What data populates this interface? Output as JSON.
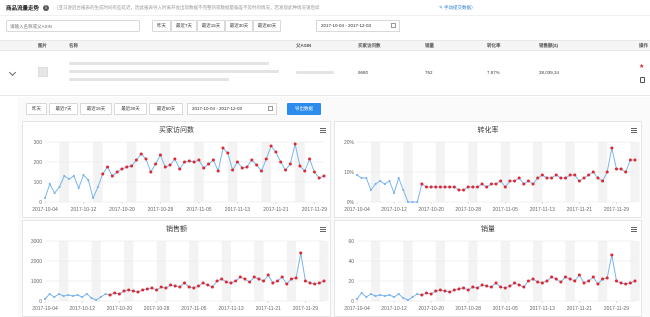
{
  "header": {
    "title": "商品流量走势",
    "info_icon": "info-circle-icon",
    "notice": "(亚马逊后台报表的生成时间有些延迟，因此报表导入时离开会出现数据不完整的或数据量偏差不及时的情况，若发现此种情况请后续",
    "link": "✎ 手动提交数据）"
  },
  "toolbar": {
    "search_placeholder": "请输入名称或父ASIN",
    "ranges": [
      "昨天",
      "最近7天",
      "最近15天",
      "最近30天",
      "最近60天"
    ],
    "date_range": "2017-10-04 - 2017-12-03"
  },
  "table": {
    "columns": [
      "图片",
      "名称",
      "父ASIN",
      "买家访问数",
      "销量",
      "转化率",
      "销售额($)",
      "操作"
    ],
    "row": {
      "visits": "9680",
      "units": "762",
      "conversion": "7.87%",
      "sales": "38,039.34"
    }
  },
  "panel": {
    "ranges": [
      "昨天",
      "最近7天",
      "最近15天",
      "最近30天",
      "最近60天"
    ],
    "date_range": "2017-10-04 - 2017-12-03",
    "export_label": "导出数据"
  },
  "colors": {
    "blue": "#7cb5ec",
    "red": "#e0262f",
    "accent": "#2b8ceb"
  },
  "chart_data": [
    {
      "type": "line",
      "title": "买家访问数",
      "x_ticks": [
        "2017-10-04",
        "2017-10-12",
        "2017-10-20",
        "2017-10-28",
        "2017-11-05",
        "2017-11-13",
        "2017-11-21",
        "2017-11-29"
      ],
      "y_ticks": [
        "300",
        "200",
        "100",
        "0"
      ],
      "ylim": [
        0,
        300
      ],
      "values": [
        20,
        90,
        45,
        75,
        130,
        115,
        130,
        70,
        135,
        110,
        20,
        75,
        140,
        175,
        130,
        150,
        165,
        175,
        180,
        210,
        240,
        215,
        150,
        190,
        235,
        175,
        185,
        215,
        165,
        200,
        205,
        200,
        210,
        170,
        190,
        210,
        155,
        270,
        245,
        160,
        200,
        170,
        175,
        210,
        185,
        155,
        215,
        280,
        250,
        200,
        160,
        190,
        290,
        180,
        155,
        215,
        150,
        120,
        130
      ],
      "red_from": 12
    },
    {
      "type": "line",
      "title": "转化率",
      "x_ticks": [
        "2017-10-04",
        "2017-10-12",
        "2017-10-20",
        "2017-10-28",
        "2017-11-05",
        "2017-11-13",
        "2017-11-21",
        "2017-11-29"
      ],
      "y_ticks": [
        "20%",
        "10%",
        "0%"
      ],
      "ylim": [
        0,
        20
      ],
      "values": [
        9,
        8,
        8,
        4,
        6,
        7,
        6,
        7,
        3,
        8,
        4,
        0,
        0,
        0,
        6,
        5,
        5,
        5,
        5,
        5,
        5,
        5,
        4,
        4,
        5,
        5,
        5,
        6,
        5,
        6,
        6,
        7,
        5,
        7,
        7,
        8,
        6,
        7,
        6,
        8,
        9,
        8,
        8,
        9,
        8,
        8,
        9,
        9,
        7,
        8,
        9,
        10,
        8,
        7,
        10,
        18,
        11,
        11,
        10,
        14,
        14
      ],
      "red_from": 14
    },
    {
      "type": "line",
      "title": "销售额",
      "x_ticks": [
        "2017-10-04",
        "2017-10-12",
        "2017-10-20",
        "2017-10-28",
        "2017-11-05",
        "2017-11-13",
        "2017-11-21",
        "2017-11-29"
      ],
      "y_ticks": [
        "3000",
        "2000",
        "1000",
        "0"
      ],
      "ylim": [
        0,
        3000
      ],
      "values": [
        100,
        350,
        200,
        350,
        250,
        300,
        250,
        300,
        200,
        350,
        150,
        50,
        200,
        350,
        300,
        400,
        350,
        500,
        550,
        500,
        450,
        550,
        600,
        650,
        550,
        700,
        650,
        800,
        750,
        700,
        900,
        700,
        650,
        750,
        900,
        800,
        700,
        1000,
        1100,
        950,
        900,
        1000,
        1200,
        1100,
        950,
        1200,
        1100,
        1000,
        1300,
        900,
        1000,
        1200,
        850,
        1100,
        1150,
        2400,
        1000,
        900,
        850,
        900,
        1000
      ],
      "red_from": 14
    },
    {
      "type": "line",
      "title": "销量",
      "x_ticks": [
        "2017-10-04",
        "2017-10-12",
        "2017-10-20",
        "2017-10-28",
        "2017-11-05",
        "2017-11-13",
        "2017-11-21",
        "2017-11-29"
      ],
      "y_ticks": [
        "60",
        "40",
        "20",
        "0"
      ],
      "ylim": [
        0,
        60
      ],
      "values": [
        2,
        8,
        4,
        7,
        5,
        6,
        5,
        6,
        4,
        7,
        3,
        1,
        4,
        7,
        6,
        8,
        7,
        10,
        11,
        10,
        9,
        11,
        12,
        13,
        11,
        14,
        13,
        16,
        15,
        14,
        18,
        14,
        13,
        15,
        18,
        16,
        14,
        20,
        22,
        19,
        18,
        20,
        24,
        22,
        19,
        24,
        22,
        20,
        26,
        18,
        20,
        24,
        17,
        22,
        23,
        46,
        20,
        18,
        17,
        18,
        20
      ],
      "red_from": 14
    }
  ]
}
